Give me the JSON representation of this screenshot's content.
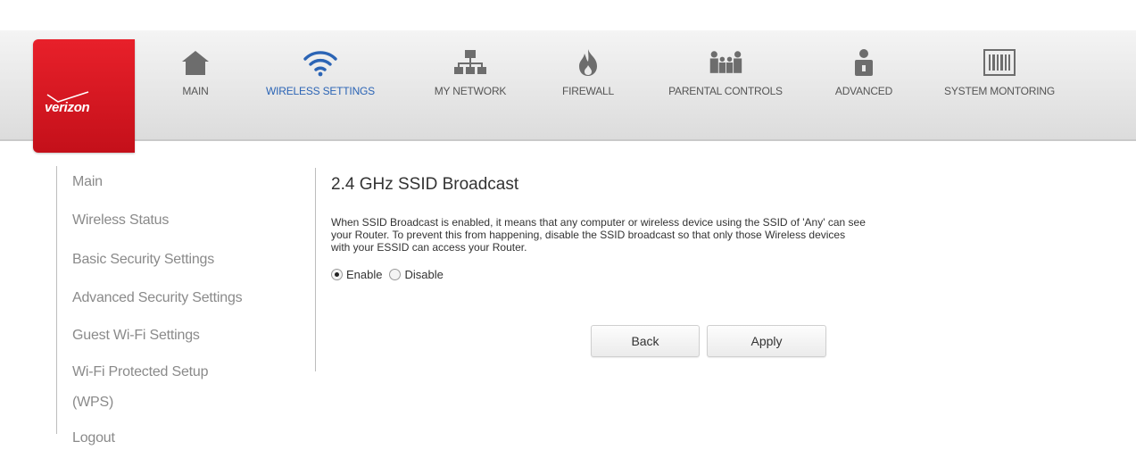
{
  "brand": {
    "name": "verizon",
    "color": "#d81e27"
  },
  "nav": [
    {
      "label": "MAIN",
      "icon": "home-icon",
      "active": false
    },
    {
      "label": "WIRELESS SETTINGS",
      "icon": "wifi-icon",
      "active": true
    },
    {
      "label": "MY NETWORK",
      "icon": "network-icon",
      "active": false
    },
    {
      "label": "FIREWALL",
      "icon": "fire-icon",
      "active": false
    },
    {
      "label": "PARENTAL CONTROLS",
      "icon": "family-icon",
      "active": false
    },
    {
      "label": "ADVANCED",
      "icon": "lock-person-icon",
      "active": false
    },
    {
      "label": "SYSTEM MONTORING",
      "icon": "barcode-icon",
      "active": false
    }
  ],
  "sidebar": {
    "items": [
      {
        "label": "Main"
      },
      {
        "label": "Wireless Status"
      },
      {
        "label": "Basic Security Settings"
      },
      {
        "label": "Advanced Security Settings"
      },
      {
        "label": "Guest Wi-Fi Settings"
      },
      {
        "label": "Wi-Fi Protected Setup"
      },
      {
        "label": "(WPS)"
      },
      {
        "label": "Logout"
      }
    ]
  },
  "main": {
    "title": "2.4 GHz SSID Broadcast",
    "description_lines": [
      "When SSID Broadcast is enabled, it means that any computer or wireless device using the SSID of 'Any' can see",
      "your Router. To prevent this from happening, disable the SSID broadcast so that only those Wireless devices",
      "with your ESSID can access your Router."
    ],
    "options": {
      "enable_label": "Enable",
      "disable_label": "Disable",
      "selected": "Enable"
    },
    "back_label": "Back",
    "apply_label": "Apply"
  },
  "colors": {
    "active_nav": "#2b64b5",
    "sidebar_text": "#8a8a8a"
  }
}
